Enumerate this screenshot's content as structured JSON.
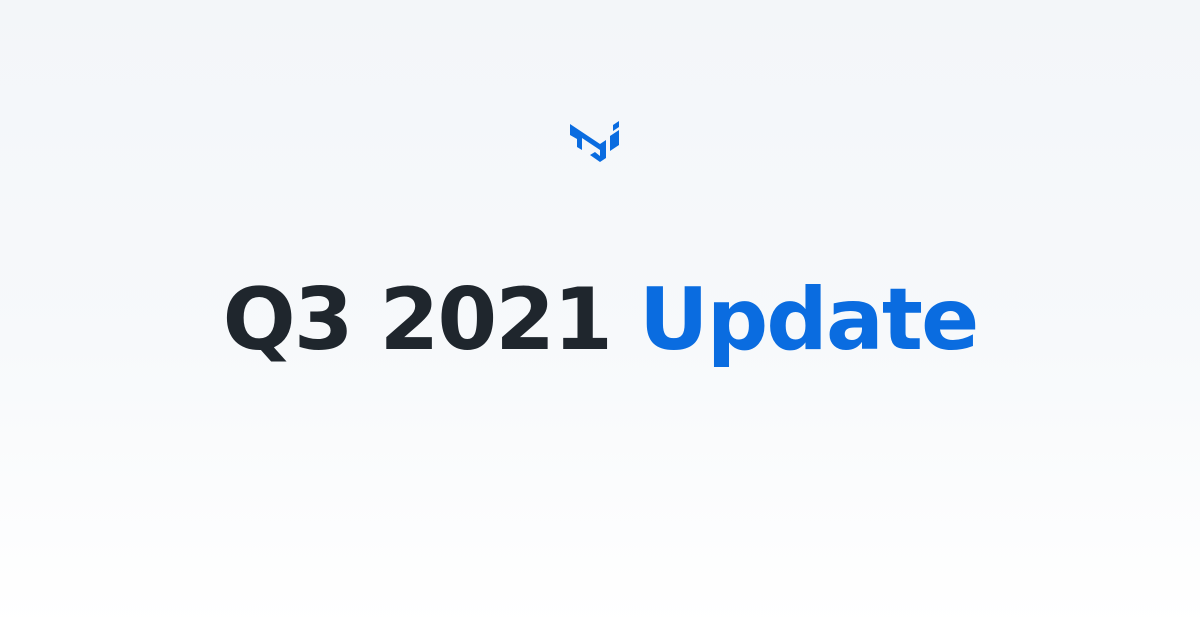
{
  "colors": {
    "text_dark": "#1f262d",
    "accent": "#0a6ce0"
  },
  "logo": {
    "icon": "mui-logo-icon"
  },
  "headline": {
    "primary": "Q3 2021",
    "accent": "Update"
  }
}
